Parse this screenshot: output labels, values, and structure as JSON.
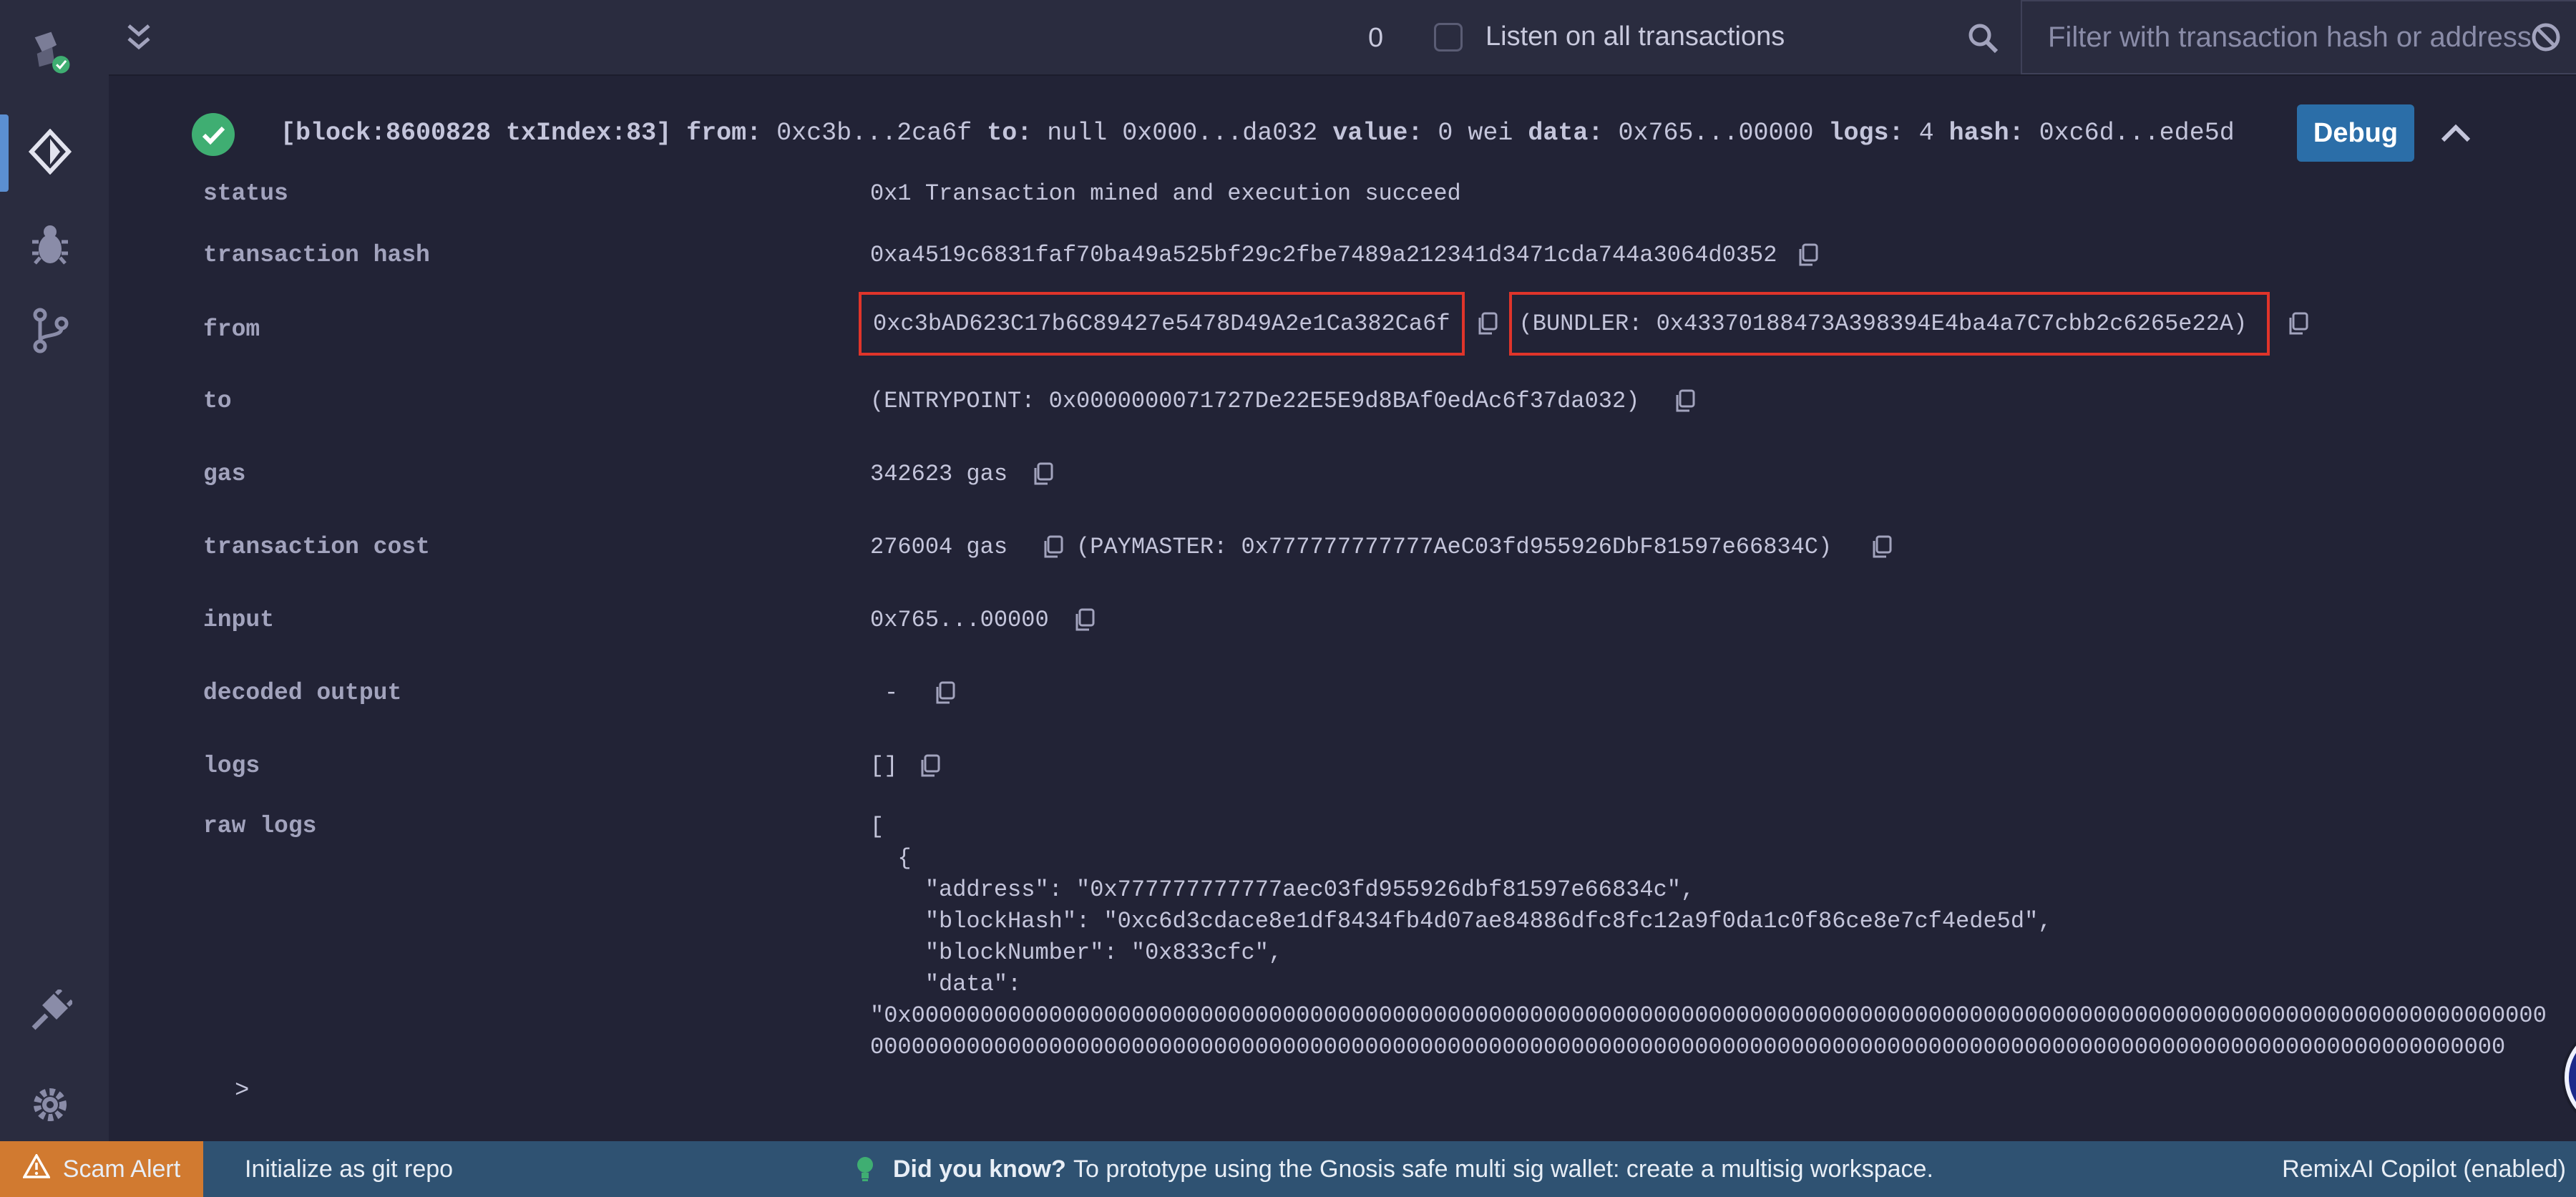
{
  "topbar": {
    "tx_count": "0",
    "listen_label": "Listen on all transactions",
    "filter_placeholder": "Filter with transaction hash or address"
  },
  "tx": {
    "summary": {
      "block": "[block:8600828 txIndex:83]",
      "from_key": "from:",
      "from_val": "0xc3b...2ca6f",
      "to_key": "to:",
      "to_val": "null 0x000...da032",
      "value_key": "value:",
      "value_val": "0 wei",
      "data_key": "data:",
      "data_val": "0x765...00000",
      "logs_key": "logs:",
      "logs_val": "4",
      "hash_key": "hash:",
      "hash_val": "0xc6d...ede5d"
    },
    "debug_label": "Debug",
    "rows": {
      "status": {
        "label": "status",
        "value": "0x1 Transaction mined and execution succeed"
      },
      "hash": {
        "label": "transaction hash",
        "value": "0xa4519c6831faf70ba49a525bf29c2fbe7489a212341d3471cda744a3064d0352"
      },
      "from": {
        "label": "from",
        "value": "0xc3bAD623C17b6C89427e5478D49A2e1Ca382Ca6f",
        "bundler": "(BUNDLER: 0x43370188473A398394E4ba4a7C7cbb2c6265e22A)"
      },
      "to": {
        "label": "to",
        "value": "(ENTRYPOINT: 0x0000000071727De22E5E9d8BAf0edAc6f37da032)"
      },
      "gas": {
        "label": "gas",
        "value": "342623 gas"
      },
      "cost": {
        "label": "transaction cost",
        "value": "276004 gas",
        "paymaster": "(PAYMASTER: 0x777777777777AeC03fd955926DbF81597e66834C)"
      },
      "input": {
        "label": "input",
        "value": "0x765...00000"
      },
      "decoded": {
        "label": "decoded output",
        "value": "-"
      },
      "logs": {
        "label": "logs",
        "value": "[]"
      },
      "raw": {
        "label": "raw logs",
        "body": "[\n  {\n    \"address\": \"0x777777777777aec03fd955926dbf81597e66834c\",\n    \"blockHash\": \"0xc6d3cdace8e1df8434fb4d07ae84886dfc8fc12a9f0da1c0f86ce8e7cf4ede5d\",\n    \"blockNumber\": \"0x833cfc\",\n    \"data\":\n\"0x00000000000000000000000000000000000000000000000000000000000000000000000000000000000000000000000000000000000000000000000\n00000000000000000000000000000000000000000000000000000000000000000000000000000000000000000000000000000000000000000000000"
      }
    }
  },
  "prompt": ">",
  "statusbar": {
    "scam": "Scam Alert",
    "git": "Initialize as git repo",
    "tip_title": "Did you know?",
    "tip_text": "To prototype using the Gnosis safe multi sig wallet: create a multisig workspace.",
    "copilot": "RemixAI Copilot (enabled)"
  },
  "colors": {
    "accent": "#5b8fd1",
    "debug": "#2b6ea8",
    "success": "#3fae72",
    "highlight": "#e0342a",
    "scam": "#d17a30",
    "statusbar": "#2f5272"
  },
  "icons": [
    "remix-logo-icon",
    "deploy-icon",
    "debugger-icon",
    "git-icon",
    "plugin-icon",
    "settings-icon",
    "collapse-icon",
    "search-icon",
    "clear-icon",
    "check-icon",
    "chevron-up-icon",
    "copy-icon",
    "warning-icon",
    "bulb-icon",
    "ai-bot-icon"
  ]
}
